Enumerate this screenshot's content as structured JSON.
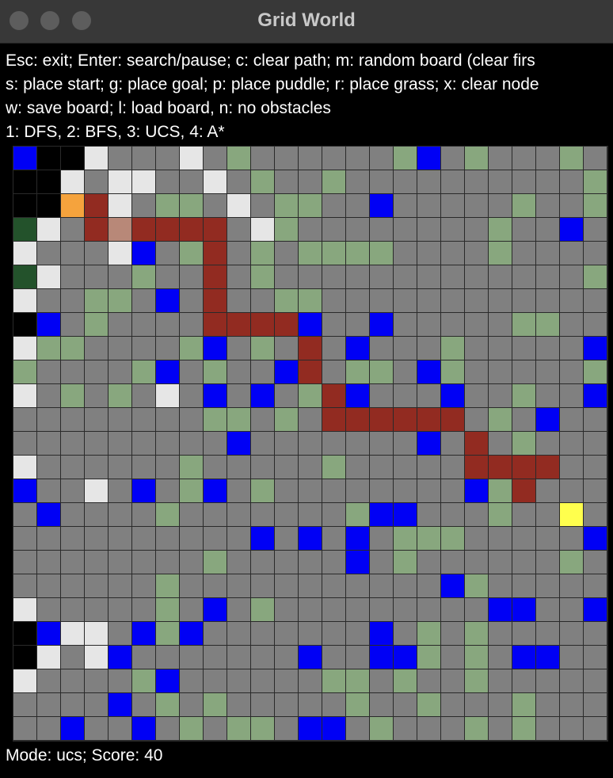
{
  "window": {
    "title": "Grid World"
  },
  "help_lines": [
    "Esc: exit; Enter: search/pause; c: clear path; m: random board (clear firs",
    "s: place start; g: place goal; p: place puddle; r: place grass; x: clear node",
    "w: save board; l: load board, n: no obstacles",
    "1: DFS, 2: BFS, 3: UCS, 4: A*"
  ],
  "status": "Mode: ucs; Score: 40",
  "colors": {
    "empty": "#808080",
    "grass": "#88a77e",
    "puddle": "#0000f5",
    "wall": "#000000",
    "explored": "#e6e6e6",
    "path": "#922b21",
    "start": "#f5a33d",
    "goal": "#ffff4d",
    "dark_green": "#23522b",
    "frontier": "#b88878"
  },
  "board": {
    "cols": 25,
    "rows": 25,
    "legend": ". empty, g grass, B puddle, K wall, W explored, P path, S start, G goal, D dark-green, F frontier",
    "rows_data": [
      "BKKW...W.g......gB.g...g.",
      "KKW.WW..W.g..g..........g",
      "KKSPW.gg.W.gg..B.....g..g",
      "DW.PFPPPP.Wg........g..B.",
      "W...WB.gP.g.gggg....g....",
      "DW...g..P.g.............g",
      "W..gg.B.P..gg............",
      "KB.g....PPPPB..B.....gg..",
      "Wgg....gB.g.P.B...g.....B",
      "g....gB.g..BP.gg.Bg.....g",
      "W.g.g.W.B.B.gPB...B..g..B",
      "........gg.g.PPPPPP.g.B..",
      ".........B.......B.P.g...",
      "W......g.....g.....PPPP..",
      "B..W.B.gB.g........BgP...",
      ".B....g.......gBB...g..G.",
      "..........B.B.B.ggg.....B",
      "........g.....B.g......g.",
      "......g...........Bg.....",
      "W.....g.B.g.........BB..B",
      "KBWW.BgB.......B.g.g.....",
      "KW.WB.......B..BBg.g.BB..",
      "W....gB......gg.g..g.....",
      "....B.g.g.....g..g...g...",
      "..B..B.g.gg.BB.g...g.g..."
    ]
  }
}
